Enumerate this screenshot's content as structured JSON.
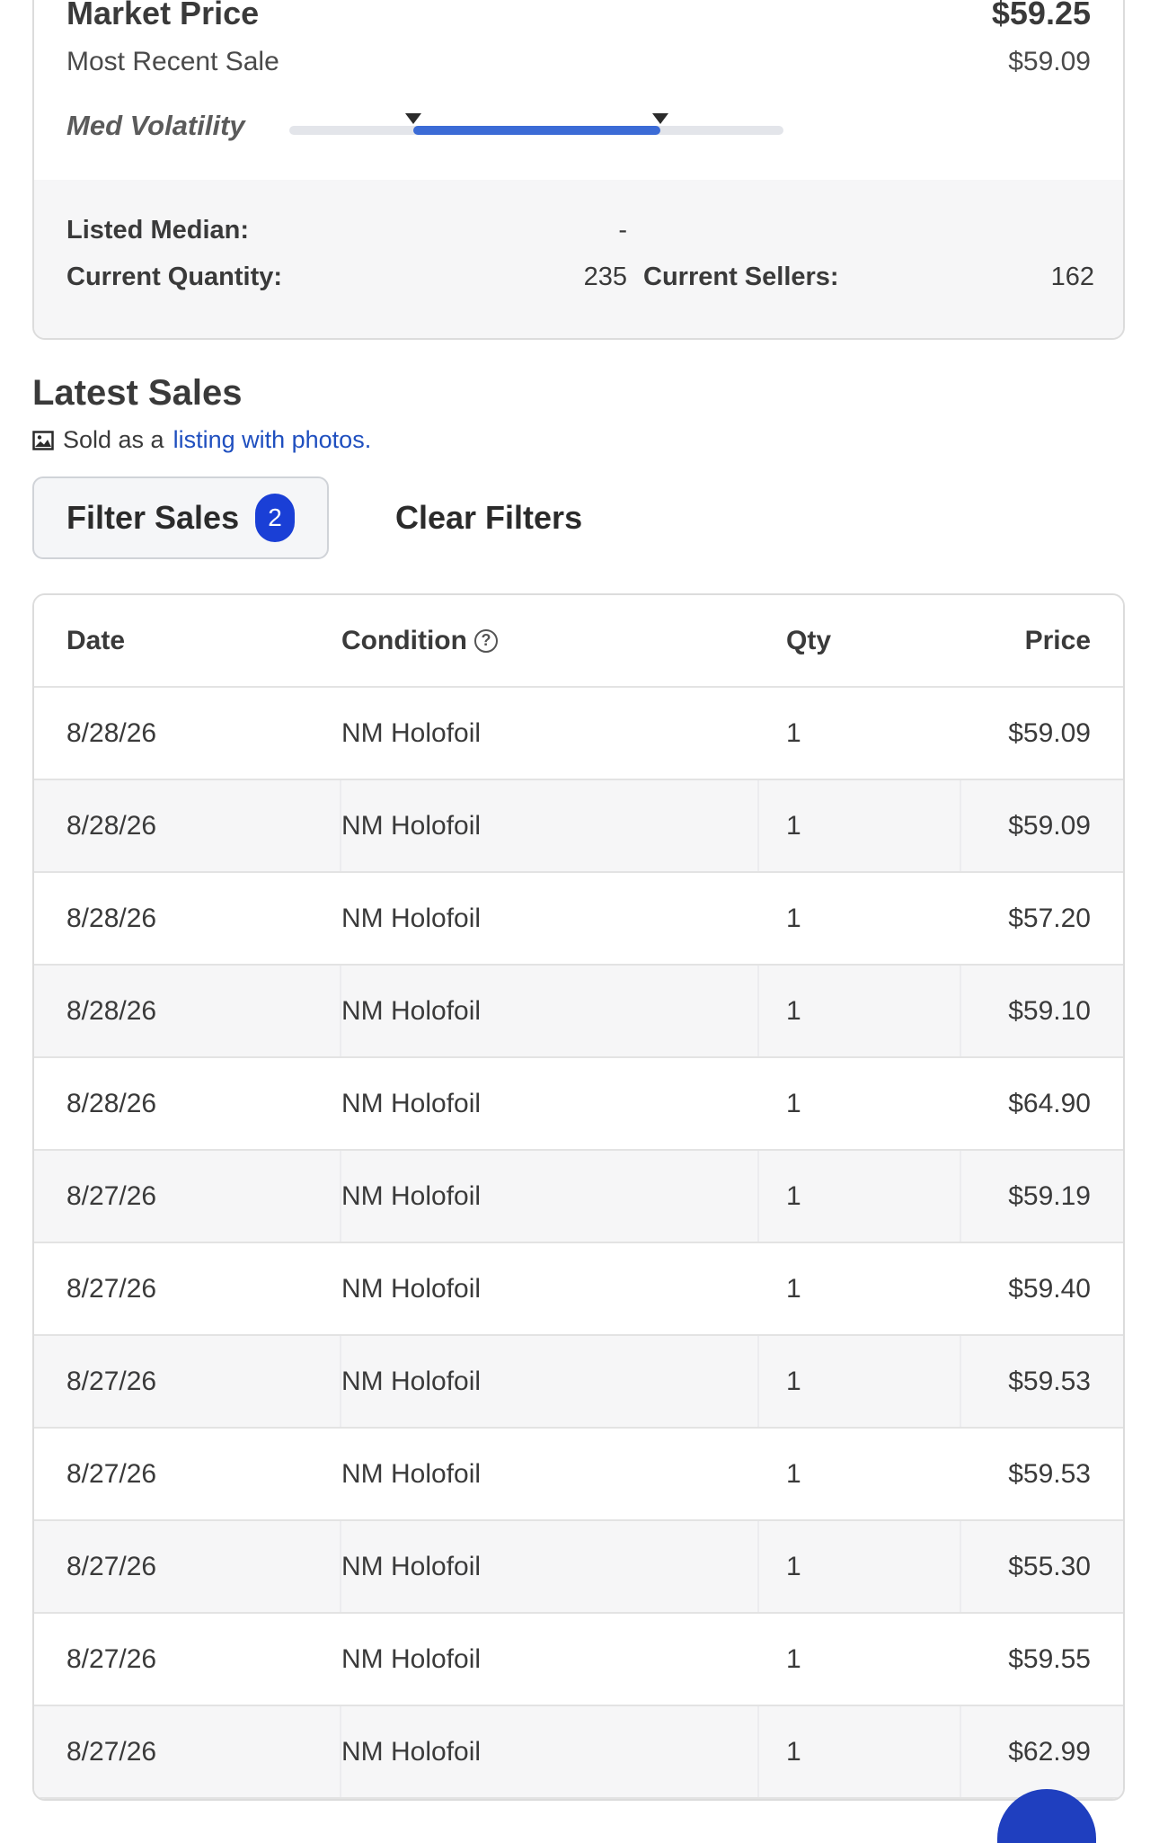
{
  "market": {
    "market_price_label": "Market Price",
    "market_price_value": "$59.25",
    "recent_sale_label": "Most Recent Sale",
    "recent_sale_value": "$59.09",
    "volatility_label": "Med Volatility",
    "volatility_range": [
      0.25,
      0.75
    ],
    "accent_color": "#3b6bd6"
  },
  "stats": {
    "listed_median_label": "Listed Median:",
    "listed_median_value": "-",
    "current_quantity_label": "Current Quantity:",
    "current_quantity_value": "235",
    "current_sellers_label": "Current Sellers:",
    "current_sellers_value": "162"
  },
  "sales": {
    "title": "Latest Sales",
    "sold_note_prefix": "Sold as a",
    "sold_note_link": "listing with photos.",
    "filter_label": "Filter Sales",
    "filter_count": "2",
    "clear_label": "Clear Filters",
    "columns": {
      "date": "Date",
      "condition": "Condition",
      "qty": "Qty",
      "price": "Price"
    },
    "rows": [
      {
        "date": "8/28/26",
        "condition": "NM Holofoil",
        "qty": "1",
        "price": "$59.09"
      },
      {
        "date": "8/28/26",
        "condition": "NM Holofoil",
        "qty": "1",
        "price": "$59.09"
      },
      {
        "date": "8/28/26",
        "condition": "NM Holofoil",
        "qty": "1",
        "price": "$57.20"
      },
      {
        "date": "8/28/26",
        "condition": "NM Holofoil",
        "qty": "1",
        "price": "$59.10"
      },
      {
        "date": "8/28/26",
        "condition": "NM Holofoil",
        "qty": "1",
        "price": "$64.90"
      },
      {
        "date": "8/27/26",
        "condition": "NM Holofoil",
        "qty": "1",
        "price": "$59.19"
      },
      {
        "date": "8/27/26",
        "condition": "NM Holofoil",
        "qty": "1",
        "price": "$59.40"
      },
      {
        "date": "8/27/26",
        "condition": "NM Holofoil",
        "qty": "1",
        "price": "$59.53"
      },
      {
        "date": "8/27/26",
        "condition": "NM Holofoil",
        "qty": "1",
        "price": "$59.53"
      },
      {
        "date": "8/27/26",
        "condition": "NM Holofoil",
        "qty": "1",
        "price": "$55.30"
      },
      {
        "date": "8/27/26",
        "condition": "NM Holofoil",
        "qty": "1",
        "price": "$59.55"
      },
      {
        "date": "8/27/26",
        "condition": "NM Holofoil",
        "qty": "1",
        "price": "$62.99"
      }
    ]
  },
  "icons": {
    "photo": "image-icon",
    "help": "help-circle-icon"
  }
}
